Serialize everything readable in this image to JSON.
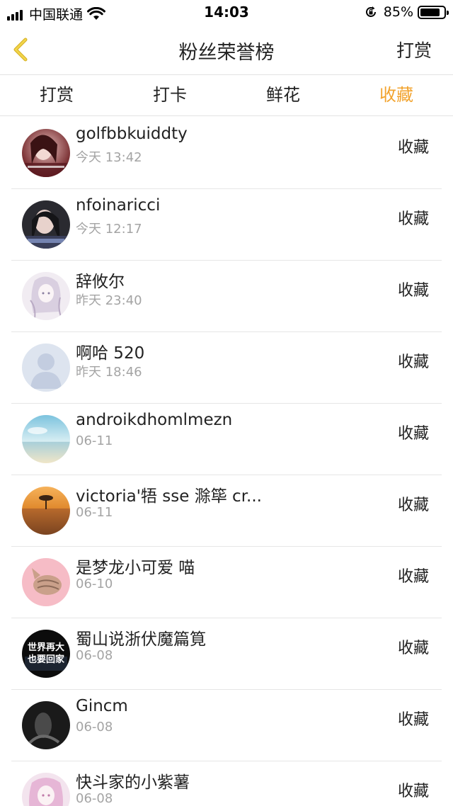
{
  "status_bar": {
    "carrier": "中国联通",
    "time": "14:03",
    "battery": "85%",
    "battery_level": 0.85
  },
  "nav": {
    "title": "粉丝荣誉榜",
    "right": "打赏"
  },
  "tabs": [
    {
      "label": "打赏",
      "active": false
    },
    {
      "label": "打卡",
      "active": false
    },
    {
      "label": "鲜花",
      "active": false
    },
    {
      "label": "收藏",
      "active": true
    }
  ],
  "colors": {
    "accent": "#f2a32e"
  },
  "fans": [
    {
      "name": "golfbbkuiddty",
      "time": "今天 13:42",
      "action": "收藏",
      "avatar": "photo-girl-red"
    },
    {
      "name": "nfoinaricci",
      "time": "今天 12:17",
      "action": "收藏",
      "avatar": "photo-girl-dark"
    },
    {
      "name": "辞攸尔",
      "time": "昨天 23:40",
      "action": "收藏",
      "avatar": "anime-girl-sketch"
    },
    {
      "name": "啊哈 520",
      "time": "昨天 18:46",
      "action": "收藏",
      "avatar": "default-avatar"
    },
    {
      "name": "androikdhomlmezn",
      "time": "06-11",
      "action": "收藏",
      "avatar": "sky-sea"
    },
    {
      "name": "victoria'牾 sse 滁筚 cr...",
      "time": "06-11",
      "action": "收藏",
      "avatar": "desert-tree"
    },
    {
      "name": "是梦龙小可爱 喵",
      "time": "06-10",
      "action": "收藏",
      "avatar": "pink-cat"
    },
    {
      "name": "蜀山说浙伏魔篇筧",
      "time": "06-08",
      "action": "收藏",
      "avatar": "text-black",
      "avatar_text": [
        "世界再大",
        "也要回家"
      ]
    },
    {
      "name": "Gincm",
      "time": "06-08",
      "action": "收藏",
      "avatar": "dark-figure"
    },
    {
      "name": "快斗家的小紫薯",
      "time": "06-08",
      "action": "收藏",
      "avatar": "anime-pink"
    }
  ]
}
